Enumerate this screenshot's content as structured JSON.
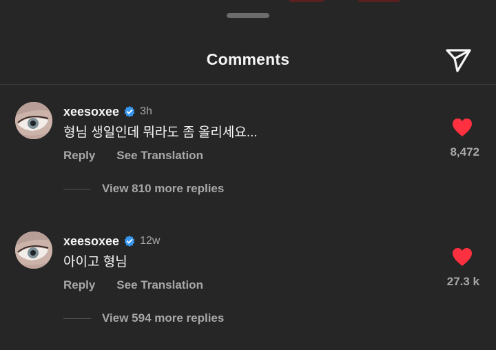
{
  "header": {
    "title": "Comments"
  },
  "colors": {
    "background": "#262626",
    "heart": "#ff3040",
    "verified": "#3897f0",
    "secondary_text": "#a8a8a8"
  },
  "comments": [
    {
      "username": "xeesoxee",
      "verified": true,
      "time": "3h",
      "text": "형님 생일인데 뭐라도 좀 올리세요...",
      "reply_label": "Reply",
      "translate_label": "See Translation",
      "likes": "8,472",
      "liked": true,
      "replies_label": "View 810 more replies"
    },
    {
      "username": "xeesoxee",
      "verified": true,
      "time": "12w",
      "text": "아이고 형님",
      "reply_label": "Reply",
      "translate_label": "See Translation",
      "likes": "27.3 k",
      "liked": true,
      "replies_label": "View 594 more replies"
    }
  ]
}
